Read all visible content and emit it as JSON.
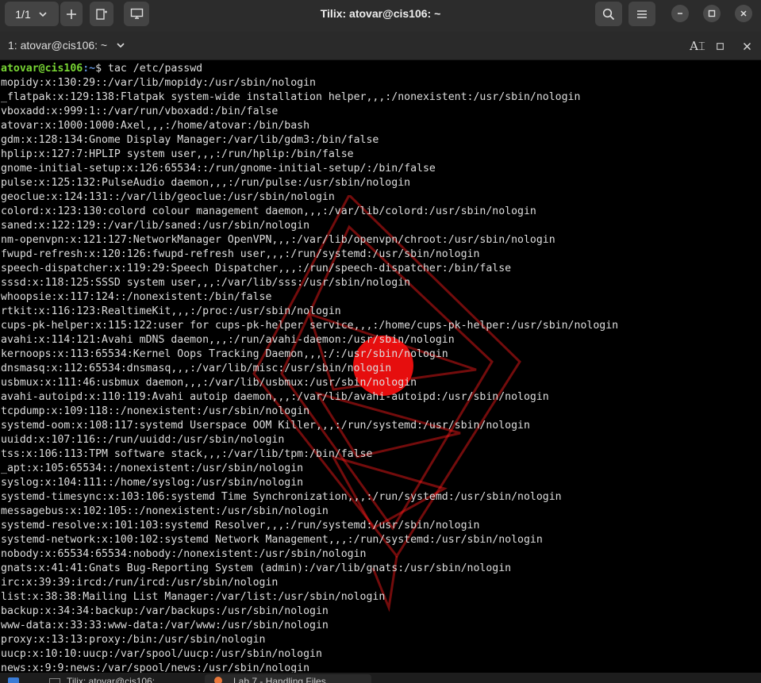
{
  "titlebar": {
    "tab_counter": "1/1",
    "title": "Tilix: atovar@cis106: ~"
  },
  "session": {
    "label": "1: atovar@cis106: ~"
  },
  "terminal": {
    "prompt_user": "atovar@cis106",
    "prompt_path": ":~",
    "prompt_symbol": "$ ",
    "command": "tac /etc/passwd",
    "lines": [
      "mopidy:x:130:29::/var/lib/mopidy:/usr/sbin/nologin",
      "_flatpak:x:129:138:Flatpak system-wide installation helper,,,:/nonexistent:/usr/sbin/nologin",
      "vboxadd:x:999:1::/var/run/vboxadd:/bin/false",
      "atovar:x:1000:1000:Axel,,,:/home/atovar:/bin/bash",
      "gdm:x:128:134:Gnome Display Manager:/var/lib/gdm3:/bin/false",
      "hplip:x:127:7:HPLIP system user,,,:/run/hplip:/bin/false",
      "gnome-initial-setup:x:126:65534::/run/gnome-initial-setup/:/bin/false",
      "pulse:x:125:132:PulseAudio daemon,,,:/run/pulse:/usr/sbin/nologin",
      "geoclue:x:124:131::/var/lib/geoclue:/usr/sbin/nologin",
      "colord:x:123:130:colord colour management daemon,,,:/var/lib/colord:/usr/sbin/nologin",
      "saned:x:122:129::/var/lib/saned:/usr/sbin/nologin",
      "nm-openvpn:x:121:127:NetworkManager OpenVPN,,,:/var/lib/openvpn/chroot:/usr/sbin/nologin",
      "fwupd-refresh:x:120:126:fwupd-refresh user,,,:/run/systemd:/usr/sbin/nologin",
      "speech-dispatcher:x:119:29:Speech Dispatcher,,,:/run/speech-dispatcher:/bin/false",
      "sssd:x:118:125:SSSD system user,,,:/var/lib/sss:/usr/sbin/nologin",
      "whoopsie:x:117:124::/nonexistent:/bin/false",
      "rtkit:x:116:123:RealtimeKit,,,:/proc:/usr/sbin/nologin",
      "cups-pk-helper:x:115:122:user for cups-pk-helper service,,,:/home/cups-pk-helper:/usr/sbin/nologin",
      "avahi:x:114:121:Avahi mDNS daemon,,,:/run/avahi-daemon:/usr/sbin/nologin",
      "kernoops:x:113:65534:Kernel Oops Tracking Daemon,,,:/:/usr/sbin/nologin",
      "dnsmasq:x:112:65534:dnsmasq,,,:/var/lib/misc:/usr/sbin/nologin",
      "usbmux:x:111:46:usbmux daemon,,,:/var/lib/usbmux:/usr/sbin/nologin",
      "avahi-autoipd:x:110:119:Avahi autoip daemon,,,:/var/lib/avahi-autoipd:/usr/sbin/nologin",
      "tcpdump:x:109:118::/nonexistent:/usr/sbin/nologin",
      "systemd-oom:x:108:117:systemd Userspace OOM Killer,,,:/run/systemd:/usr/sbin/nologin",
      "uuidd:x:107:116::/run/uuidd:/usr/sbin/nologin",
      "tss:x:106:113:TPM software stack,,,:/var/lib/tpm:/bin/false",
      "_apt:x:105:65534::/nonexistent:/usr/sbin/nologin",
      "syslog:x:104:111::/home/syslog:/usr/sbin/nologin",
      "systemd-timesync:x:103:106:systemd Time Synchronization,,,:/run/systemd:/usr/sbin/nologin",
      "messagebus:x:102:105::/nonexistent:/usr/sbin/nologin",
      "systemd-resolve:x:101:103:systemd Resolver,,,:/run/systemd:/usr/sbin/nologin",
      "systemd-network:x:100:102:systemd Network Management,,,:/run/systemd:/usr/sbin/nologin",
      "nobody:x:65534:65534:nobody:/nonexistent:/usr/sbin/nologin",
      "gnats:x:41:41:Gnats Bug-Reporting System (admin):/var/lib/gnats:/usr/sbin/nologin",
      "irc:x:39:39:ircd:/run/ircd:/usr/sbin/nologin",
      "list:x:38:38:Mailing List Manager:/var/list:/usr/sbin/nologin",
      "backup:x:34:34:backup:/var/backups:/usr/sbin/nologin",
      "www-data:x:33:33:www-data:/var/www:/usr/sbin/nologin",
      "proxy:x:13:13:proxy:/bin:/usr/sbin/nologin",
      "uucp:x:10:10:uucp:/var/spool/uucp:/usr/sbin/nologin",
      "news:x:9:9:news:/var/spool/news:/usr/sbin/nologin"
    ]
  },
  "taskbar": {
    "items": [
      "Tilix: atovar@cis106:",
      "Lab 7 - Handling Files"
    ]
  },
  "colors": {
    "terminal_bg": "#000000",
    "terminal_fg": "#dedede",
    "prompt_user": "#78d634",
    "prompt_path": "#5f8fd6",
    "wallpaper_accent": "#ff1a1a"
  }
}
